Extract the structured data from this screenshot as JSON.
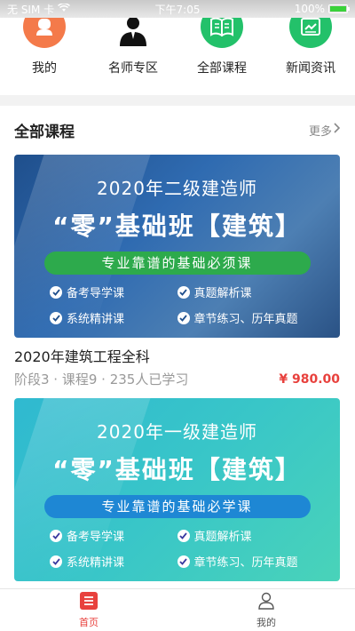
{
  "status_bar": {
    "carrier": "无 SIM 卡",
    "time": "下午7:05",
    "battery": "100%",
    "battery_level": 1.0
  },
  "nav": {
    "items": [
      {
        "label": "我的",
        "icon": "user-icon",
        "color": "#f47a4a"
      },
      {
        "label": "名师专区",
        "icon": "graduate-teacher-icon",
        "color": "#111111"
      },
      {
        "label": "全部课程",
        "icon": "book-icon",
        "color": "#23c16a"
      },
      {
        "label": "新闻资讯",
        "icon": "news-icon",
        "color": "#23c16a"
      }
    ]
  },
  "section": {
    "title": "全部课程",
    "more": "更多"
  },
  "courses": [
    {
      "banner_title": "2020年二级建造师",
      "banner_main": "“零”基础班【建筑】",
      "banner_pill": "专业靠谱的基础必须课",
      "features": [
        "备考导学课",
        "真题解析课",
        "系统精讲课",
        "章节练习、历年真题"
      ],
      "title": "2020年建筑工程全科",
      "meta": "阶段3 · 课程9 · 235人已学习",
      "price": "¥ 980.00"
    },
    {
      "banner_title": "2020年一级建造师",
      "banner_main": "“零”基础班【建筑】",
      "banner_pill": "专业靠谱的基础必学课",
      "features": [
        "备考导学课",
        "真题解析课",
        "系统精讲课",
        "章节练习、历年真题"
      ]
    }
  ],
  "tabbar": {
    "items": [
      {
        "label": "首页",
        "icon": "home-list-icon",
        "active": true
      },
      {
        "label": "我的",
        "icon": "profile-icon",
        "active": false
      }
    ],
    "active_color": "#e8413d",
    "inactive_color": "#555555"
  }
}
